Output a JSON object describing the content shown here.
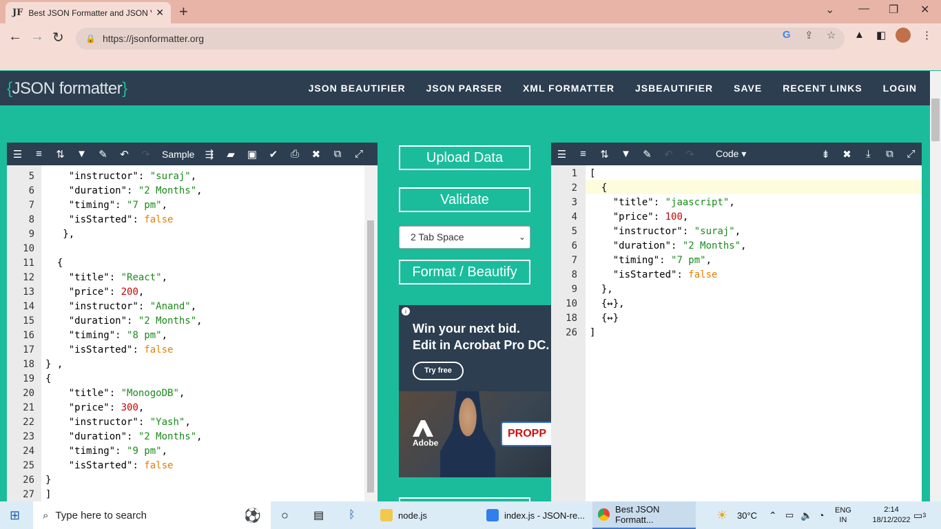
{
  "browser": {
    "tab_icon": "JF",
    "tab_title": "Best JSON Formatter and JSON V",
    "url": "https://jsonformatter.org"
  },
  "site": {
    "logo_open": "{",
    "logo_text": "JSON formatter",
    "logo_close": "}",
    "nav": [
      "JSON BEAUTIFIER",
      "JSON PARSER",
      "XML FORMATTER",
      "JSBEAUTIFIER",
      "SAVE",
      "RECENT LINKS",
      "LOGIN"
    ]
  },
  "left_editor": {
    "toolbar_label": "Sample",
    "lines": [
      {
        "n": "5",
        "t": [
          [
            "    ",
            ""
          ],
          [
            "\"instructor\"",
            ""
          ],
          [
            ": ",
            ""
          ],
          [
            "\"suraj\"",
            "s"
          ],
          [
            ",",
            ""
          ]
        ]
      },
      {
        "n": "6",
        "t": [
          [
            "    ",
            ""
          ],
          [
            "\"duration\"",
            ""
          ],
          [
            ": ",
            ""
          ],
          [
            "\"2 Months\"",
            "s"
          ],
          [
            ",",
            ""
          ]
        ]
      },
      {
        "n": "7",
        "t": [
          [
            "    ",
            ""
          ],
          [
            "\"timing\"",
            ""
          ],
          [
            ": ",
            ""
          ],
          [
            "\"7 pm\"",
            "s"
          ],
          [
            ",",
            ""
          ]
        ]
      },
      {
        "n": "8",
        "t": [
          [
            "    ",
            ""
          ],
          [
            "\"isStarted\"",
            ""
          ],
          [
            ": ",
            ""
          ],
          [
            "false",
            "b"
          ]
        ]
      },
      {
        "n": "9",
        "t": [
          [
            "   },",
            ""
          ]
        ]
      },
      {
        "n": "10",
        "t": [
          [
            "",
            ""
          ]
        ]
      },
      {
        "n": "11",
        "t": [
          [
            "  {",
            ""
          ]
        ]
      },
      {
        "n": "12",
        "t": [
          [
            "    ",
            ""
          ],
          [
            "\"title\"",
            ""
          ],
          [
            ": ",
            ""
          ],
          [
            "\"React\"",
            "s"
          ],
          [
            ",",
            ""
          ]
        ]
      },
      {
        "n": "13",
        "t": [
          [
            "    ",
            ""
          ],
          [
            "\"price\"",
            ""
          ],
          [
            ": ",
            ""
          ],
          [
            "200",
            "n"
          ],
          [
            ",",
            ""
          ]
        ]
      },
      {
        "n": "14",
        "t": [
          [
            "    ",
            ""
          ],
          [
            "\"instructor\"",
            ""
          ],
          [
            ": ",
            ""
          ],
          [
            "\"Anand\"",
            "s"
          ],
          [
            ",",
            ""
          ]
        ]
      },
      {
        "n": "15",
        "t": [
          [
            "    ",
            ""
          ],
          [
            "\"duration\"",
            ""
          ],
          [
            ": ",
            ""
          ],
          [
            "\"2 Months\"",
            "s"
          ],
          [
            ",",
            ""
          ]
        ]
      },
      {
        "n": "16",
        "t": [
          [
            "    ",
            ""
          ],
          [
            "\"timing\"",
            ""
          ],
          [
            ": ",
            ""
          ],
          [
            "\"8 pm\"",
            "s"
          ],
          [
            ",",
            ""
          ]
        ]
      },
      {
        "n": "17",
        "t": [
          [
            "    ",
            ""
          ],
          [
            "\"isStarted\"",
            ""
          ],
          [
            ": ",
            ""
          ],
          [
            "false",
            "b"
          ]
        ]
      },
      {
        "n": "18",
        "t": [
          [
            "} ,",
            ""
          ]
        ]
      },
      {
        "n": "19",
        "t": [
          [
            "{",
            ""
          ]
        ]
      },
      {
        "n": "20",
        "t": [
          [
            "    ",
            ""
          ],
          [
            "\"title\"",
            ""
          ],
          [
            ": ",
            ""
          ],
          [
            "\"MonogoDB\"",
            "s"
          ],
          [
            ",",
            ""
          ]
        ]
      },
      {
        "n": "21",
        "t": [
          [
            "    ",
            ""
          ],
          [
            "\"price\"",
            ""
          ],
          [
            ": ",
            ""
          ],
          [
            "300",
            "n"
          ],
          [
            ",",
            ""
          ]
        ]
      },
      {
        "n": "22",
        "t": [
          [
            "    ",
            ""
          ],
          [
            "\"instructor\"",
            ""
          ],
          [
            ": ",
            ""
          ],
          [
            "\"Yash\"",
            "s"
          ],
          [
            ",",
            ""
          ]
        ]
      },
      {
        "n": "23",
        "t": [
          [
            "    ",
            ""
          ],
          [
            "\"duration\"",
            ""
          ],
          [
            ": ",
            ""
          ],
          [
            "\"2 Months\"",
            "s"
          ],
          [
            ",",
            ""
          ]
        ]
      },
      {
        "n": "24",
        "t": [
          [
            "    ",
            ""
          ],
          [
            "\"timing\"",
            ""
          ],
          [
            ": ",
            ""
          ],
          [
            "\"9 pm\"",
            "s"
          ],
          [
            ",",
            ""
          ]
        ]
      },
      {
        "n": "25",
        "t": [
          [
            "    ",
            ""
          ],
          [
            "\"isStarted\"",
            ""
          ],
          [
            ": ",
            ""
          ],
          [
            "false",
            "b"
          ]
        ]
      },
      {
        "n": "26",
        "t": [
          [
            "}",
            ""
          ]
        ]
      },
      {
        "n": "27",
        "t": [
          [
            "]",
            ""
          ]
        ]
      }
    ]
  },
  "middle": {
    "upload": "Upload Data",
    "validate": "Validate",
    "indent_selected": "2 Tab Space",
    "format": "Format / Beautify"
  },
  "ad": {
    "line1": "Win your next bid.",
    "line2": "Edit in Acrobat Pro DC.",
    "try": "Try free",
    "tag": "PROPP",
    "brand": "Adobe"
  },
  "right_editor": {
    "toolbar_label": "Code",
    "lines": [
      {
        "n": "1",
        "t": [
          [
            "[",
            ""
          ]
        ]
      },
      {
        "n": "2",
        "t": [
          [
            "  {",
            ""
          ]
        ]
      },
      {
        "n": "3",
        "t": [
          [
            "    ",
            ""
          ],
          [
            "\"title\"",
            ""
          ],
          [
            ": ",
            ""
          ],
          [
            "\"jaascript\"",
            "s"
          ],
          [
            ",",
            ""
          ]
        ]
      },
      {
        "n": "4",
        "t": [
          [
            "    ",
            ""
          ],
          [
            "\"price\"",
            ""
          ],
          [
            ": ",
            ""
          ],
          [
            "100",
            "n"
          ],
          [
            ",",
            ""
          ]
        ]
      },
      {
        "n": "5",
        "t": [
          [
            "    ",
            ""
          ],
          [
            "\"instructor\"",
            ""
          ],
          [
            ": ",
            ""
          ],
          [
            "\"suraj\"",
            "s"
          ],
          [
            ",",
            ""
          ]
        ]
      },
      {
        "n": "6",
        "t": [
          [
            "    ",
            ""
          ],
          [
            "\"duration\"",
            ""
          ],
          [
            ": ",
            ""
          ],
          [
            "\"2 Months\"",
            "s"
          ],
          [
            ",",
            ""
          ]
        ]
      },
      {
        "n": "7",
        "t": [
          [
            "    ",
            ""
          ],
          [
            "\"timing\"",
            ""
          ],
          [
            ": ",
            ""
          ],
          [
            "\"7 pm\"",
            "s"
          ],
          [
            ",",
            ""
          ]
        ]
      },
      {
        "n": "8",
        "t": [
          [
            "    ",
            ""
          ],
          [
            "\"isStarted\"",
            ""
          ],
          [
            ": ",
            ""
          ],
          [
            "false",
            "b"
          ]
        ]
      },
      {
        "n": "9",
        "t": [
          [
            "  },",
            ""
          ]
        ]
      },
      {
        "n": "10",
        "t": [
          [
            "  {↔},",
            ""
          ]
        ]
      },
      {
        "n": "18",
        "t": [
          [
            "  {↔}",
            ""
          ]
        ]
      },
      {
        "n": "26",
        "t": [
          [
            "]",
            ""
          ]
        ]
      }
    ]
  },
  "taskbar": {
    "search_placeholder": "Type here to search",
    "apps": [
      "node.js",
      "index.js - JSON-re...",
      "Best JSON Formatt..."
    ],
    "weather": "30°C",
    "lang1": "ENG",
    "lang2": "IN",
    "time": "2:14",
    "date": "18/12/2022",
    "notif": "3"
  }
}
